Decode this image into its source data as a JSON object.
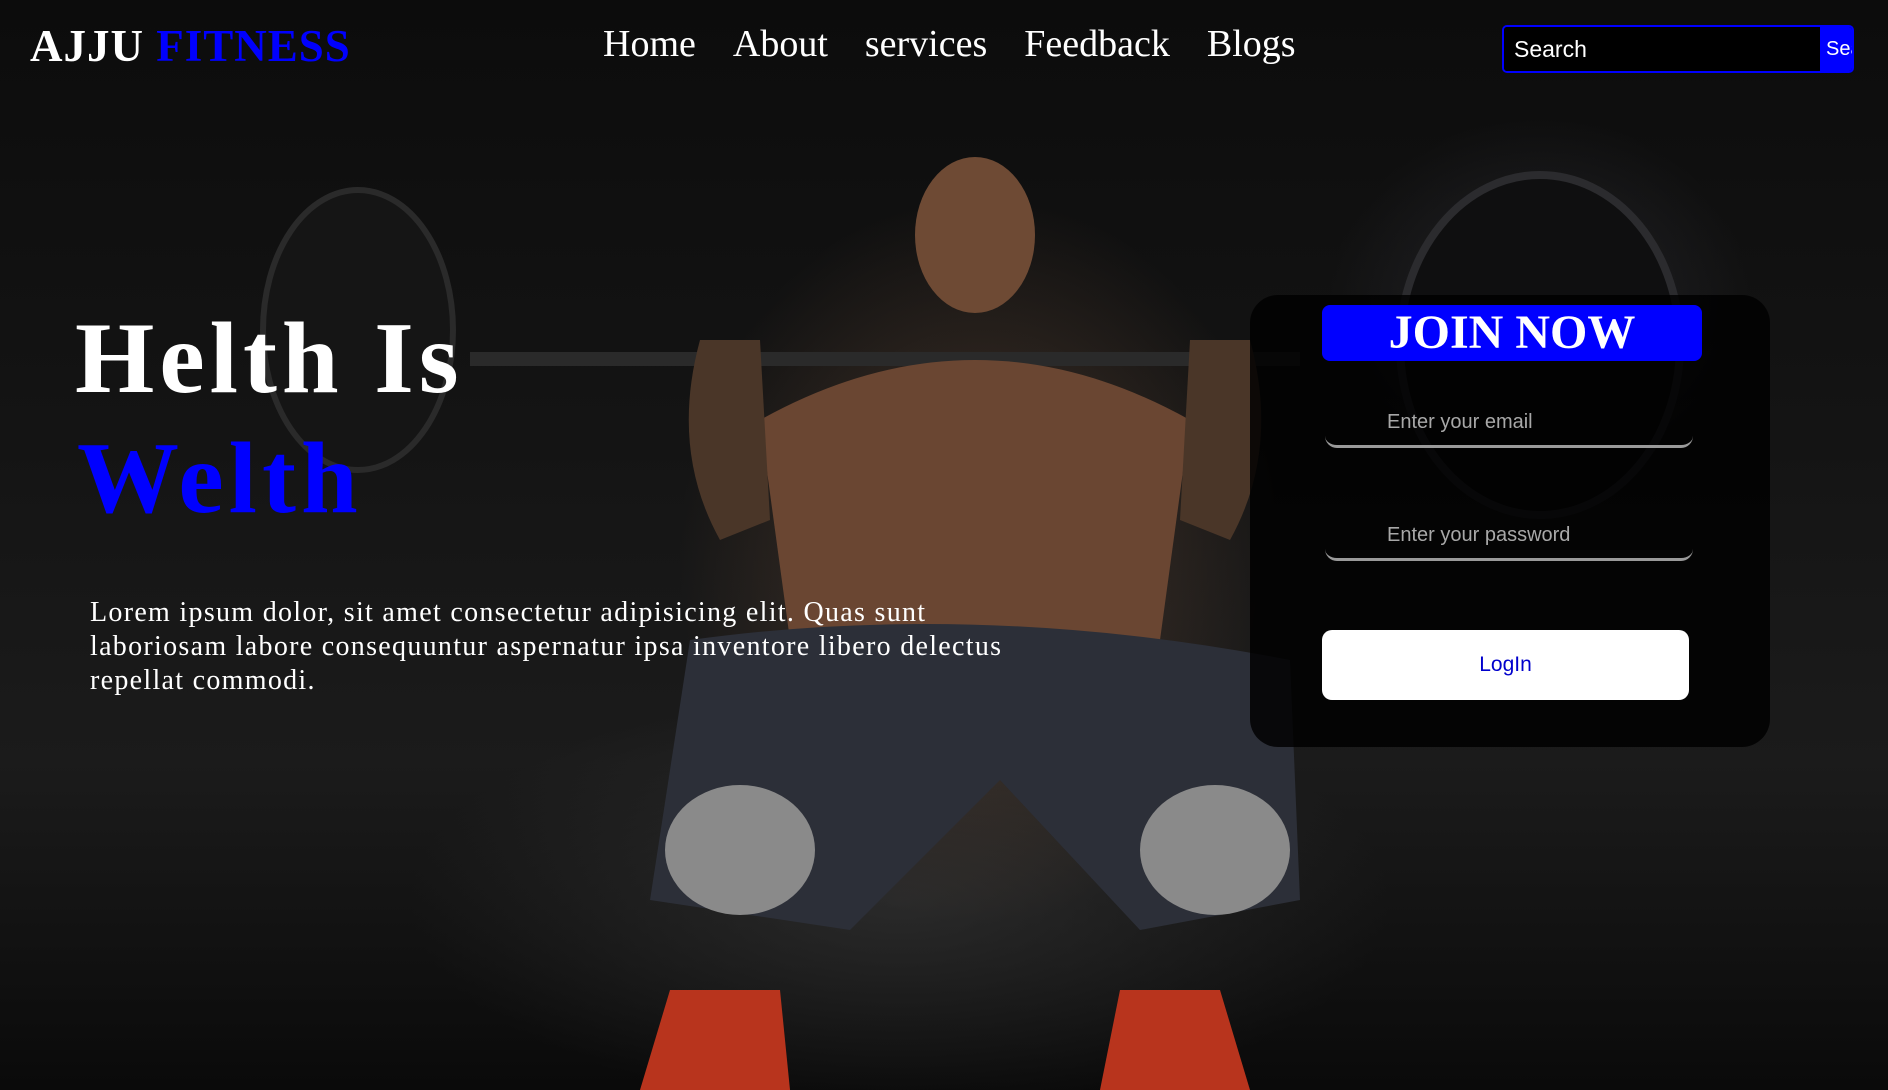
{
  "header": {
    "logo_main": "AJJU",
    "logo_accent": "FITNESS",
    "nav": [
      "Home",
      "About",
      "services",
      "Feedback",
      "Blogs"
    ],
    "search_placeholder": "Search",
    "search_button": "Search"
  },
  "hero": {
    "headline_line1": "Helth Is",
    "headline_line2": "Welth",
    "body": "Lorem ipsum dolor, sit amet consectetur adipisicing elit. Quas sunt laboriosam labore consequuntur aspernatur ipsa inventore libero delectus repellat commodi."
  },
  "form": {
    "title": "JOIN NOW",
    "email_placeholder": "Enter your email",
    "password_placeholder": "Enter your password",
    "login_label": "LogIn"
  },
  "colors": {
    "accent": "#0000ff",
    "background": "#000000",
    "text": "#ffffff"
  }
}
